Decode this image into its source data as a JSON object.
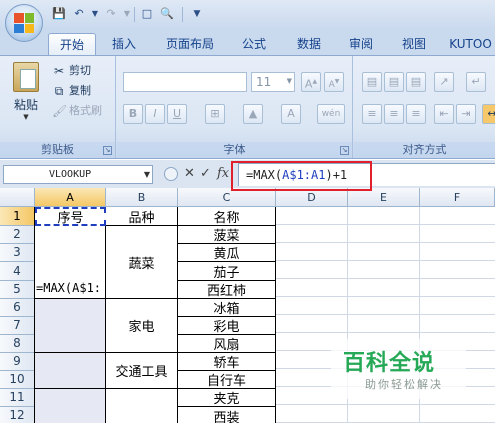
{
  "qat": {
    "icons": [
      "save-icon",
      "undo-icon",
      "dropdown-icon",
      "redo-icon",
      "new-icon",
      "print-preview-icon",
      "customize-icon"
    ]
  },
  "tabs": [
    "开始",
    "插入",
    "页面布局",
    "公式",
    "数据",
    "审阅",
    "视图",
    "KUTOO"
  ],
  "active_tab": "开始",
  "ribbon": {
    "clipboard": {
      "paste": "粘贴",
      "cut": "剪切",
      "copy": "复制",
      "format_painter": "格式刷",
      "label": "剪贴板"
    },
    "font": {
      "font_name": "",
      "font_size": "11",
      "grow": "A",
      "shrink": "A",
      "bold": "B",
      "italic": "I",
      "underline": "U",
      "phonetic": "wén",
      "label": "字体"
    },
    "alignment": {
      "label": "对齐方式"
    }
  },
  "formula_bar": {
    "name_box": "VLOOKUP",
    "cancel": "✕",
    "enter": "✓",
    "fx": "fx",
    "formula_prefix": "=MAX(",
    "formula_ref": "A$1:A1",
    "formula_suffix": ")+1"
  },
  "colors": {
    "highlight": "#e0202a",
    "formula_ref": "#1f3fbf",
    "watermark": "#26a957"
  },
  "sheet": {
    "columns": [
      "A",
      "B",
      "C",
      "D",
      "E",
      "F"
    ],
    "rows": [
      "1",
      "2",
      "3",
      "4",
      "5",
      "6",
      "7",
      "8",
      "9",
      "10",
      "11",
      "12"
    ],
    "headers": {
      "a1": "序号",
      "b1": "品种",
      "c1": "名称"
    },
    "editing_cell_text": "=MAX(A$1:",
    "categories": [
      "蔬菜",
      "家电",
      "交通工具"
    ],
    "names": [
      "菠菜",
      "黄瓜",
      "茄子",
      "西红柿",
      "冰箱",
      "彩电",
      "风扇",
      "轿车",
      "自行车",
      "夹克",
      "西装"
    ]
  },
  "watermark": {
    "title": "百科全说",
    "subtitle": "助你轻松解决"
  }
}
